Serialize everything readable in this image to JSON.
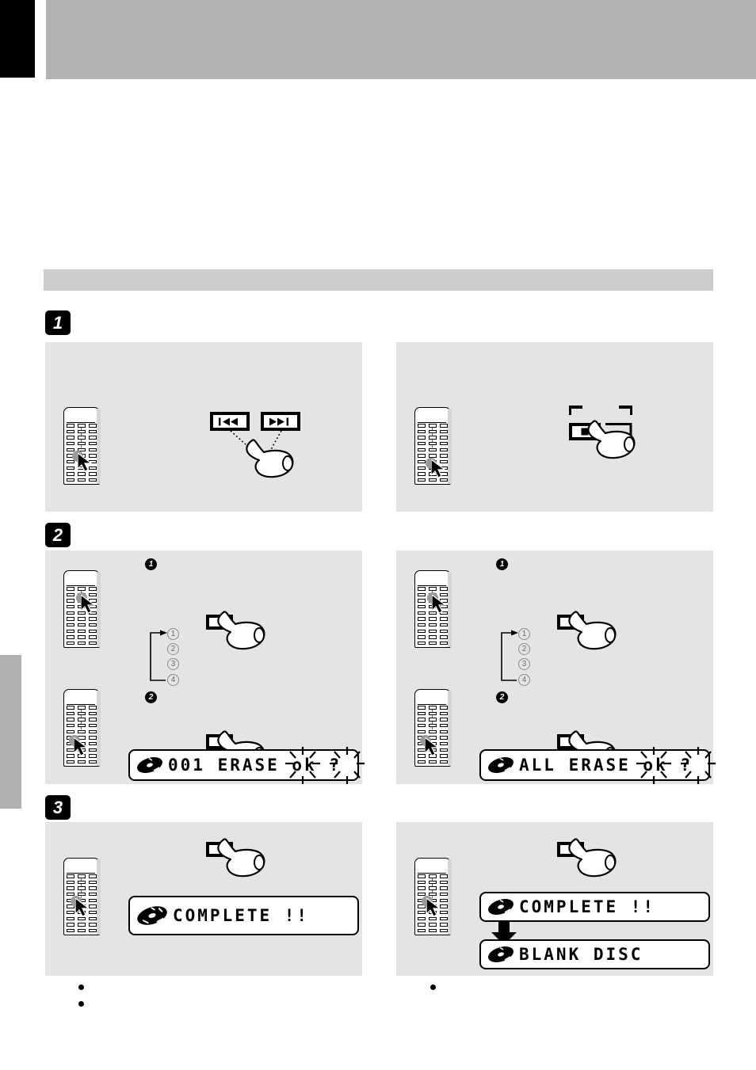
{
  "page": {
    "background_color": "#ffffff",
    "header_band_color": "#b3b3b3",
    "header_tab_color": "#000000",
    "panel_color": "#e4e4e4",
    "section_bar_color": "#cccccc",
    "side_tab_color": "#b0b0b0"
  },
  "section": {
    "title": ""
  },
  "steps": [
    {
      "number": "1",
      "left": {
        "buttons": [
          {
            "icon": "skip-backward-icon",
            "label": ""
          },
          {
            "icon": "skip-forward-icon",
            "label": ""
          }
        ],
        "display": null
      },
      "right": {
        "buttons": [
          {
            "icon": "stop-icon",
            "label": ""
          }
        ],
        "display": null
      }
    },
    {
      "number": "2",
      "left": {
        "substeps": [
          "1",
          "2"
        ],
        "cycle_numbers": [
          "1",
          "2",
          "3",
          "4"
        ],
        "display": {
          "text": "001 ERASE ok ?",
          "flashing": true,
          "flash_target": "ok ?"
        }
      },
      "right": {
        "substeps": [
          "1",
          "2"
        ],
        "cycle_numbers": [
          "1",
          "2",
          "3",
          "4"
        ],
        "display": {
          "text": "ALL ERASE ok ?",
          "flashing": true,
          "flash_target": "ok ?"
        }
      }
    },
    {
      "number": "3",
      "left": {
        "displays": [
          {
            "text": "COMPLETE !!"
          }
        ],
        "notes": [
          "",
          ""
        ]
      },
      "right": {
        "displays": [
          {
            "text": "COMPLETE !!"
          },
          {
            "text": "BLANK DISC"
          }
        ],
        "notes": [
          ""
        ]
      }
    }
  ],
  "icons": {
    "skip_backward": "skip-backward-icon",
    "skip_forward": "skip-forward-icon",
    "stop": "stop-icon",
    "disc": "disc-icon",
    "hand": "pointing-hand-icon",
    "cursor": "arrow-cursor-icon",
    "down_arrow": "down-arrow-icon"
  }
}
